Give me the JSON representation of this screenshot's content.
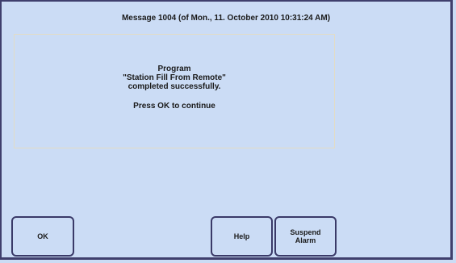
{
  "dialog": {
    "title": "Message 1004 (of Mon., 11. October 2010 10:31:24 AM)",
    "message": {
      "line1": "Program",
      "line2": "\"Station Fill From Remote\"",
      "line3": "completed successfully.",
      "line4": "Press OK to continue"
    }
  },
  "buttons": {
    "ok_label": "OK",
    "help_label": "Help",
    "suspend_label_line1": "Suspend",
    "suspend_label_line2": "Alarm"
  },
  "colors": {
    "background": "#cbdcf5",
    "border": "#3f3f6d",
    "message_box_border": "#e2dcc6"
  }
}
